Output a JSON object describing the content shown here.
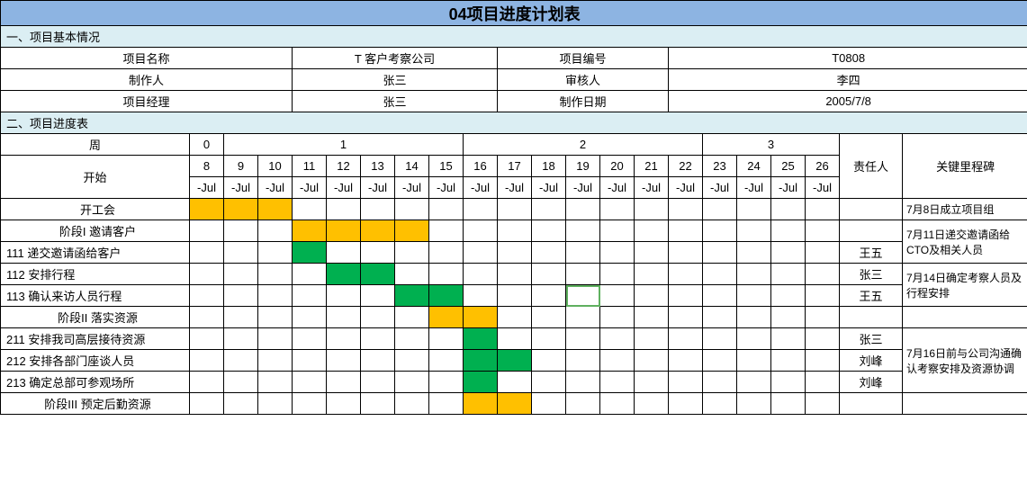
{
  "title": "04项目进度计划表",
  "section1": "一、项目基本情况",
  "section2": "二、项目进度表",
  "info": {
    "r1": {
      "a": "项目名称",
      "b": "T 客户考察公司",
      "c": "项目编号",
      "d": "T0808"
    },
    "r2": {
      "a": "制作人",
      "b": "张三",
      "c": "审核人",
      "d": "李四"
    },
    "r3": {
      "a": "项目经理",
      "b": "张三",
      "c": "制作日期",
      "d": "2005/7/8"
    }
  },
  "header": {
    "week": "周",
    "weeks": [
      "0",
      "1",
      "2",
      "3"
    ],
    "start": "开始",
    "dates_top": [
      "8",
      "9",
      "10",
      "11",
      "12",
      "13",
      "14",
      "15",
      "16",
      "17",
      "18",
      "19",
      "20",
      "21",
      "22",
      "23",
      "24",
      "25",
      "26"
    ],
    "dates_bot": [
      "-Jul",
      "-Jul",
      "-Jul",
      "-Jul",
      "-Jul",
      "-Jul",
      "-Jul",
      "-Jul",
      "-Jul",
      "-Jul",
      "-Jul",
      "-Jul",
      "-Jul",
      "-Jul",
      "-Jul",
      "-Jul",
      "-Jul",
      "-Jul",
      "-Jul"
    ],
    "owner": "责任人",
    "milestone": "关键里程碑"
  },
  "rows": {
    "r0": {
      "label": "开工会",
      "owner": "",
      "milestone": "7月8日成立项目组"
    },
    "r1": {
      "label": "阶段I 邀请客户",
      "owner": ""
    },
    "r2": {
      "label": "111 递交邀请函给客户",
      "owner": "王五"
    },
    "m12": "7月11日递交邀请函给CTO及相关人员",
    "r3": {
      "label": "112 安排行程",
      "owner": "张三"
    },
    "r4": {
      "label": "113 确认来访人员行程",
      "owner": "王五"
    },
    "m34": "7月14日确定考察人员及行程安排",
    "r5": {
      "label": "阶段II 落实资源",
      "owner": ""
    },
    "r6": {
      "label": "211 安排我司高层接待资源",
      "owner": "张三"
    },
    "r7": {
      "label": "212 安排各部门座谈人员",
      "owner": "刘峰"
    },
    "r8": {
      "label": "213 确定总部可参观场所",
      "owner": "刘峰"
    },
    "m678": "7月16日前与公司沟通确认考察安排及资源协调",
    "r9": {
      "label": "阶段III 预定后勤资源",
      "owner": ""
    }
  },
  "chart_data": {
    "type": "gantt",
    "title": "04项目进度计划表",
    "date_range": [
      "2005-07-08",
      "2005-07-26"
    ],
    "tasks": [
      {
        "id": "kickoff",
        "label": "开工会",
        "color": "yellow",
        "start": "2005-07-08",
        "end": "2005-07-10",
        "owner": "",
        "milestone": "7月8日成立项目组"
      },
      {
        "id": "phase1",
        "label": "阶段I 邀请客户",
        "color": "yellow",
        "start": "2005-07-11",
        "end": "2005-07-14",
        "owner": ""
      },
      {
        "id": "111",
        "label": "递交邀请函给客户",
        "color": "green",
        "start": "2005-07-11",
        "end": "2005-07-11",
        "owner": "王五",
        "milestone": "7月11日递交邀请函给CTO及相关人员"
      },
      {
        "id": "112",
        "label": "安排行程",
        "color": "green",
        "start": "2005-07-12",
        "end": "2005-07-13",
        "owner": "张三"
      },
      {
        "id": "113",
        "label": "确认来访人员行程",
        "color": "green",
        "start": "2005-07-14",
        "end": "2005-07-15",
        "owner": "王五",
        "milestone": "7月14日确定考察人员及行程安排"
      },
      {
        "id": "phase2",
        "label": "阶段II 落实资源",
        "color": "yellow",
        "start": "2005-07-15",
        "end": "2005-07-16",
        "owner": ""
      },
      {
        "id": "211",
        "label": "安排我司高层接待资源",
        "color": "green",
        "start": "2005-07-16",
        "end": "2005-07-16",
        "owner": "张三"
      },
      {
        "id": "212",
        "label": "安排各部门座谈人员",
        "color": "green",
        "start": "2005-07-16",
        "end": "2005-07-17",
        "owner": "刘峰",
        "milestone": "7月16日前与公司沟通确认考察安排及资源协调"
      },
      {
        "id": "213",
        "label": "确定总部可参观场所",
        "color": "green",
        "start": "2005-07-16",
        "end": "2005-07-16",
        "owner": "刘峰"
      },
      {
        "id": "phase3",
        "label": "阶段III 预定后勤资源",
        "color": "yellow",
        "start": "2005-07-16",
        "end": "2005-07-17",
        "owner": ""
      }
    ]
  }
}
